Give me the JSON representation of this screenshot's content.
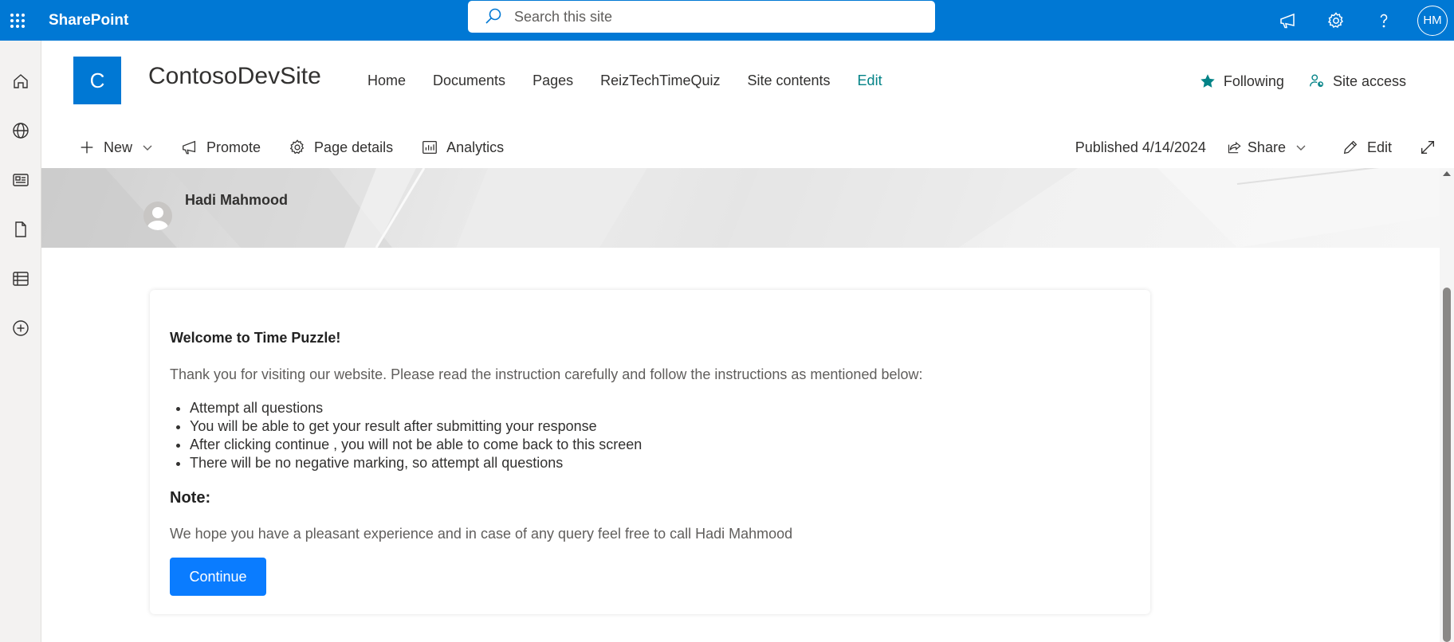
{
  "suite": {
    "brand": "SharePoint",
    "search_placeholder": "Search this site",
    "user_initials": "HM",
    "icons": [
      "app-launcher-icon",
      "megaphone-icon",
      "gear-icon",
      "help-icon"
    ]
  },
  "rail": {
    "items": [
      "home-icon",
      "globe-icon",
      "news-icon",
      "document-icon",
      "list-icon",
      "add-circle-icon"
    ]
  },
  "site": {
    "logo_letter": "C",
    "title": "ContosoDevSite",
    "nav": [
      "Home",
      "Documents",
      "Pages",
      "ReizTechTimeQuiz",
      "Site contents"
    ],
    "nav_edit": "Edit",
    "following_label": "Following",
    "site_access_label": "Site access"
  },
  "commandbar": {
    "new_label": "New",
    "promote_label": "Promote",
    "page_details_label": "Page details",
    "analytics_label": "Analytics",
    "published_label": "Published 4/14/2024",
    "share_label": "Share",
    "edit_label": "Edit"
  },
  "banner": {
    "author_name": "Hadi Mahmood"
  },
  "card": {
    "title": "Welcome to Time Puzzle!",
    "intro": "Thank you for visiting our website. Please read the instruction carefully and follow the instructions as mentioned below:",
    "bullets": [
      "Attempt all questions",
      "You will be able to get your result after submitting your response",
      "After clicking continue , you will not be able to come back to this screen",
      "There will be no negative marking, so attempt all questions"
    ],
    "note_heading": "Note:",
    "message": "We hope you have a pleasant experience and in case of any query feel free to call Hadi Mahmood",
    "continue_label": "Continue"
  },
  "colors": {
    "suite_bar": "#0078d4",
    "accent_teal": "#038387",
    "continue_button": "#0a7cff"
  }
}
